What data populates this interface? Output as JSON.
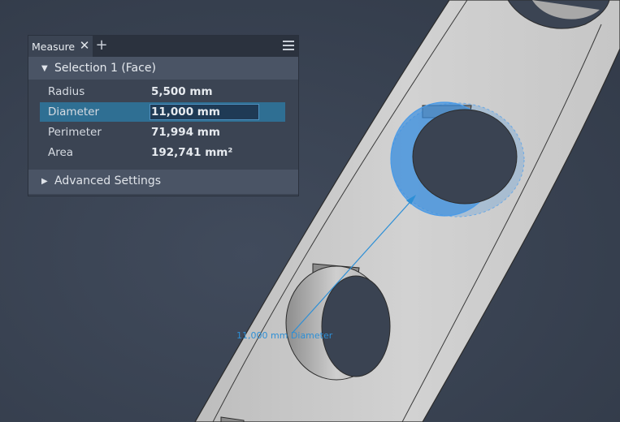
{
  "panel": {
    "tab_label": "Measure",
    "close_glyph": "✕",
    "add_glyph": "+",
    "menu_icon": "hamburger-menu-icon",
    "section_title": "Selection 1 (Face)",
    "section_caret": "▼",
    "rows": [
      {
        "label": "Radius",
        "value": "5,500 mm"
      },
      {
        "label": "Diameter",
        "value": "11,000 mm"
      },
      {
        "label": "Perimeter",
        "value": "71,994 mm"
      },
      {
        "label": "Area",
        "value": "192,741 mm²"
      }
    ],
    "selected_row": 1,
    "advanced_title": "Advanced Settings",
    "advanced_caret": "▶"
  },
  "viewport": {
    "dimension_label": "11,000 mm Diameter",
    "colors": {
      "background": "#3a4352",
      "part": "#cfcfcf",
      "highlight": "#3b8ede",
      "dimension": "#2d8fd6"
    }
  }
}
